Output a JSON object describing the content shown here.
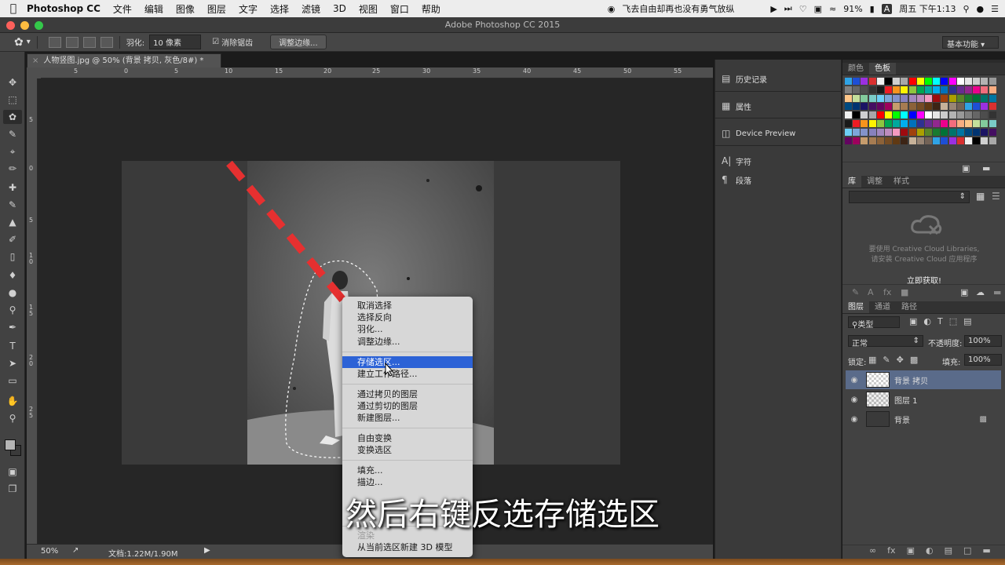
{
  "menubar": {
    "apple": "",
    "app_name": "Photoshop CC",
    "menus": [
      "文件",
      "编辑",
      "图像",
      "图层",
      "文字",
      "选择",
      "滤镜",
      "3D",
      "视图",
      "窗口",
      "帮助"
    ],
    "music_text": "飞去自由却再也没有勇气放纵",
    "battery": "91%",
    "time": "周五 下午1:13"
  },
  "titlebar": {
    "title": "Adobe Photoshop CC 2015"
  },
  "options": {
    "feather_label": "羽化:",
    "feather_value": "10 像素",
    "antialias_label": "消除锯齿",
    "refine_edge_button": "调整边缘...",
    "workspace": "基本功能"
  },
  "document": {
    "tab_title": "人物竖图.jpg @ 50% (背景 拷贝, 灰色/8#) *",
    "zoom": "50%",
    "doc_info": "文档:1.22M/1.90M"
  },
  "ruler": {
    "h_ticks": [
      "5",
      "0",
      "5",
      "10",
      "15",
      "20",
      "25",
      "30",
      "35",
      "40",
      "45",
      "50",
      "55"
    ],
    "v_ticks": [
      "5",
      "0",
      "5",
      "1 0",
      "1 5",
      "2 0",
      "2 5"
    ]
  },
  "context_menu": {
    "items": [
      {
        "label": "取消选择",
        "state": "normal"
      },
      {
        "label": "选择反向",
        "state": "normal"
      },
      {
        "label": "羽化...",
        "state": "normal"
      },
      {
        "label": "调整边缘...",
        "state": "normal"
      },
      {
        "label": "存储选区...",
        "state": "selected"
      },
      {
        "label": "建立工作路径...",
        "state": "normal"
      },
      {
        "label": "通过拷贝的图层",
        "state": "normal"
      },
      {
        "label": "通过剪切的图层",
        "state": "normal"
      },
      {
        "label": "新建图层...",
        "state": "normal"
      },
      {
        "label": "自由变换",
        "state": "normal"
      },
      {
        "label": "变换选区",
        "state": "normal"
      },
      {
        "label": "填充...",
        "state": "normal"
      },
      {
        "label": "描边...",
        "state": "normal"
      },
      {
        "label": "渲染",
        "state": "disabled"
      },
      {
        "label": "从当前选区新建 3D 模型",
        "state": "normal"
      }
    ]
  },
  "mid_panels": {
    "history": "历史记录",
    "properties": "属性",
    "device_preview": "Device Preview",
    "character": "字符",
    "paragraph": "段落"
  },
  "color_panel": {
    "tabs": [
      "颜色",
      "色板"
    ]
  },
  "library_panel": {
    "tabs": [
      "库",
      "调整",
      "样式"
    ],
    "message_line1": "要使用 Creative Cloud Libraries,",
    "message_line2": "请安装 Creative Cloud 应用程序",
    "get_now": "立即获取!"
  },
  "layers_panel": {
    "tabs": [
      "图层",
      "通道",
      "路径"
    ],
    "filter_kind": "类型",
    "blend_mode": "正常",
    "opacity_label": "不透明度:",
    "opacity_value": "100%",
    "lock_label": "锁定:",
    "fill_label": "填充:",
    "fill_value": "100%",
    "layers": [
      {
        "name": "背景 拷贝",
        "selected": true
      },
      {
        "name": "图层 1",
        "selected": false
      },
      {
        "name": "背景",
        "selected": false,
        "locked": true
      }
    ]
  },
  "subtitle": "然后右键反选存储选区",
  "colors": {
    "menu_highlight": "#2c62d6",
    "arrow_red": "#e63030",
    "selected_layer": "#5a6b8a"
  }
}
